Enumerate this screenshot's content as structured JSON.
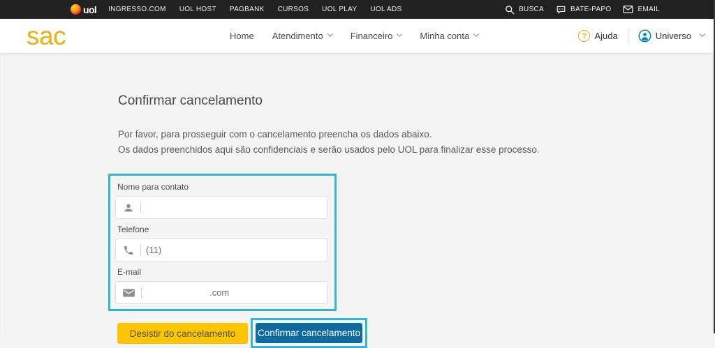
{
  "topbar": {
    "logo_text": "uol",
    "links": [
      "INGRESSO.COM",
      "UOL HOST",
      "PAGBANK",
      "CURSOS",
      "UOL PLAY",
      "UOL ADS"
    ],
    "actions": [
      {
        "icon": "search-icon",
        "label": "BUSCA"
      },
      {
        "icon": "chat-bubble-icon",
        "label": "BATE-PAPO"
      },
      {
        "icon": "envelope-icon",
        "label": "EMAIL"
      }
    ]
  },
  "header": {
    "logo_text": "sac",
    "nav": [
      {
        "label": "Home",
        "dropdown": false
      },
      {
        "label": "Atendimento",
        "dropdown": true
      },
      {
        "label": "Financeiro",
        "dropdown": true
      },
      {
        "label": "Minha conta",
        "dropdown": true
      }
    ],
    "help_icon": "?",
    "help_label": "Ajuda",
    "account_label": "Universo"
  },
  "main": {
    "title": "Confirmar cancelamento",
    "intro_line1": "Por favor, para prosseguir com o cancelamento preencha os dados abaixo.",
    "intro_line2": "Os dados preenchidos aqui são confidenciais e serão usados pelo UOL para finalizar esse processo.",
    "form": {
      "fields": [
        {
          "label": "Nome para contato",
          "icon": "person-icon",
          "value": ""
        },
        {
          "label": "Telefone",
          "icon": "phone-icon",
          "value": "(11)"
        },
        {
          "label": "E-mail",
          "icon": "envelope-icon",
          "value": ".com"
        }
      ]
    },
    "buttons": {
      "secondary": "Desistir do cancelamento",
      "primary": "Confirmar cancelamento"
    }
  },
  "colors": {
    "topbar_bg": "#212121",
    "brand_gold": "#e9b10e",
    "highlight_cyan": "#2fb6d8",
    "button_yellow": "#fdc500",
    "button_blue": "#0f6a9f",
    "page_bg": "#f4f4f4"
  }
}
